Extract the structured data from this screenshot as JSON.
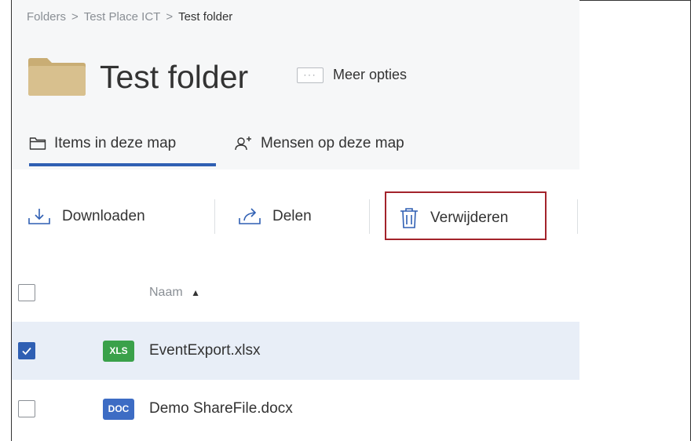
{
  "breadcrumb": {
    "items": [
      "Folders",
      "Test Place ICT",
      "Test folder"
    ],
    "separator": ">"
  },
  "folder": {
    "title": "Test folder",
    "icon": "folder-icon",
    "more_options_dots": "···",
    "more_options_label": "Meer opties"
  },
  "tabs": [
    {
      "label": "Items in deze map",
      "icon": "folder-outline-icon",
      "active": true
    },
    {
      "label": "Mensen op deze map",
      "icon": "add-person-icon",
      "active": false
    }
  ],
  "toolbar": {
    "download_label": "Downloaden",
    "share_label": "Delen",
    "delete_label": "Verwijderen"
  },
  "list": {
    "name_header": "Naam",
    "sort_indicator": "▲",
    "rows": [
      {
        "badge": "XLS",
        "name": "EventExport.xlsx",
        "checked": true
      },
      {
        "badge": "DOC",
        "name": "Demo ShareFile.docx",
        "checked": false
      }
    ]
  },
  "colors": {
    "accent": "#2f5fb3",
    "highlight_border": "#a3232b",
    "selected_row": "#e8eef7",
    "xls_badge": "#3aa14a",
    "doc_badge": "#3d6cc4",
    "folder": "#d8c08e"
  }
}
